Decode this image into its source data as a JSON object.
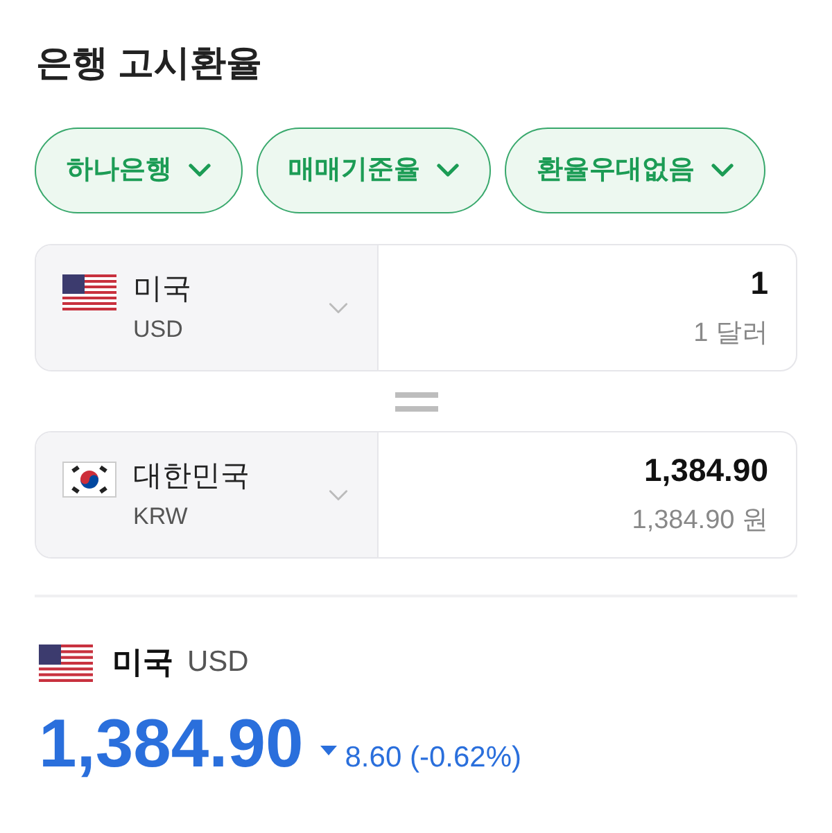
{
  "title": "은행 고시환율",
  "filters": [
    {
      "label": "하나은행"
    },
    {
      "label": "매매기준율"
    },
    {
      "label": "환율우대없음"
    }
  ],
  "converter": [
    {
      "kind": "us",
      "country": "미국",
      "code": "USD",
      "amount": "1",
      "amount_words": "1 달러"
    },
    {
      "kind": "kr",
      "country": "대한민국",
      "code": "KRW",
      "amount": "1,384.90",
      "amount_words": "1,384.90 원"
    }
  ],
  "summary": {
    "kind": "us",
    "country": "미국",
    "code": "USD",
    "rate": "1,384.90",
    "falling": true,
    "change": "8.60 (-0.62%)"
  }
}
